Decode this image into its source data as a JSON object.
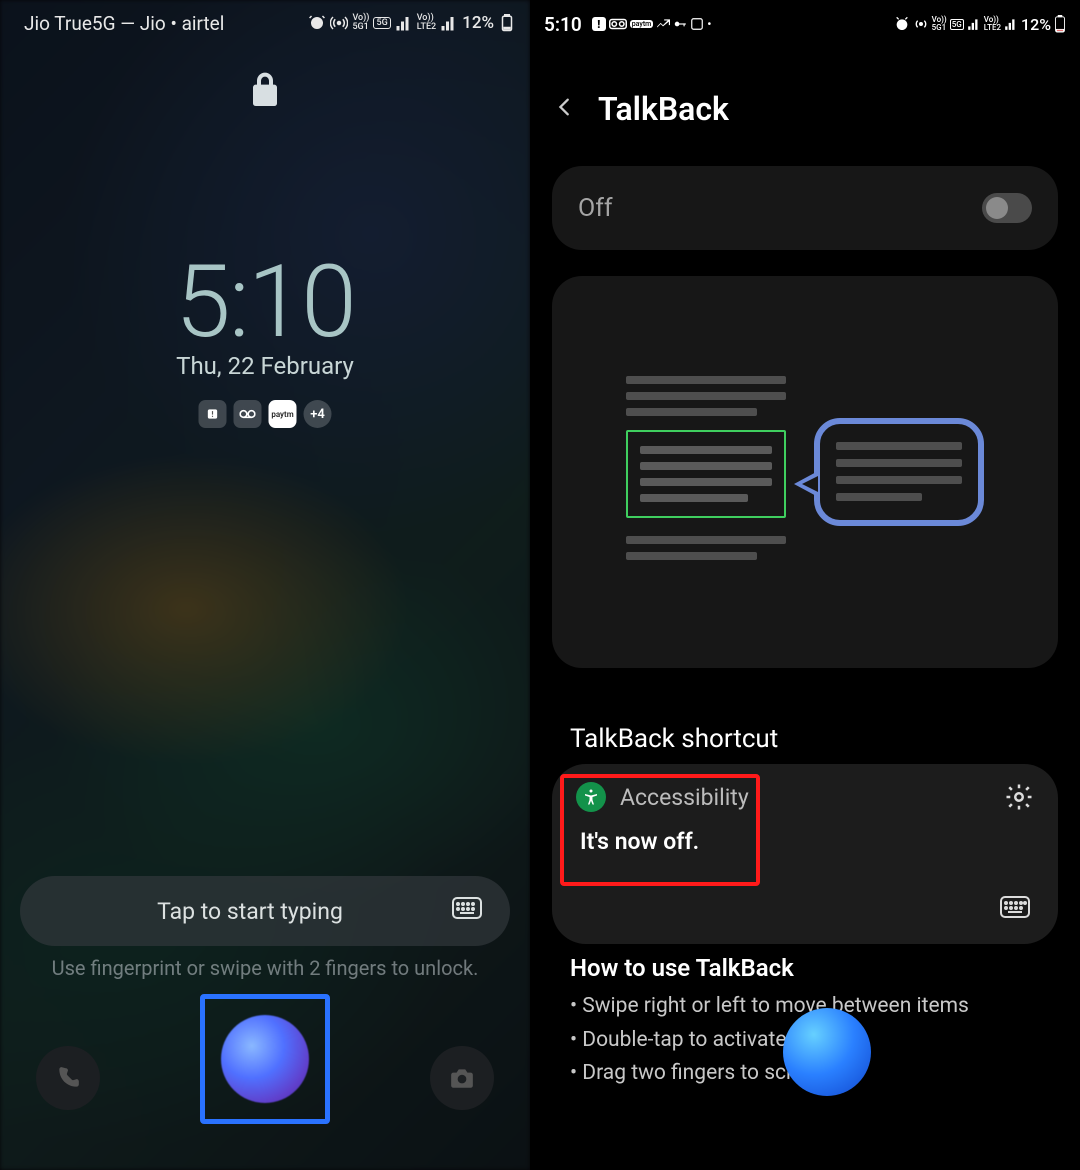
{
  "left": {
    "status": {
      "carrier": "Jio True5G — Jio • airtel",
      "battery": "12%"
    },
    "clock": "5:10",
    "date": "Thu, 22 February",
    "more_badge": "+4",
    "search_hint": "Tap to start typing",
    "unlock_hint": "Use fingerprint or swipe with 2 fingers to unlock."
  },
  "right": {
    "status": {
      "time": "5:10",
      "battery": "12%"
    },
    "title": "TalkBack",
    "switch_label": "Off",
    "shortcut_heading": "TalkBack shortcut",
    "toast": {
      "app": "Accessibility",
      "message": "It's now off."
    },
    "howto": {
      "title": "How to use TalkBack",
      "items": [
        "Swipe right or left to move between items",
        "Double-tap to activate an item",
        "Drag two fingers to scroll"
      ]
    }
  }
}
